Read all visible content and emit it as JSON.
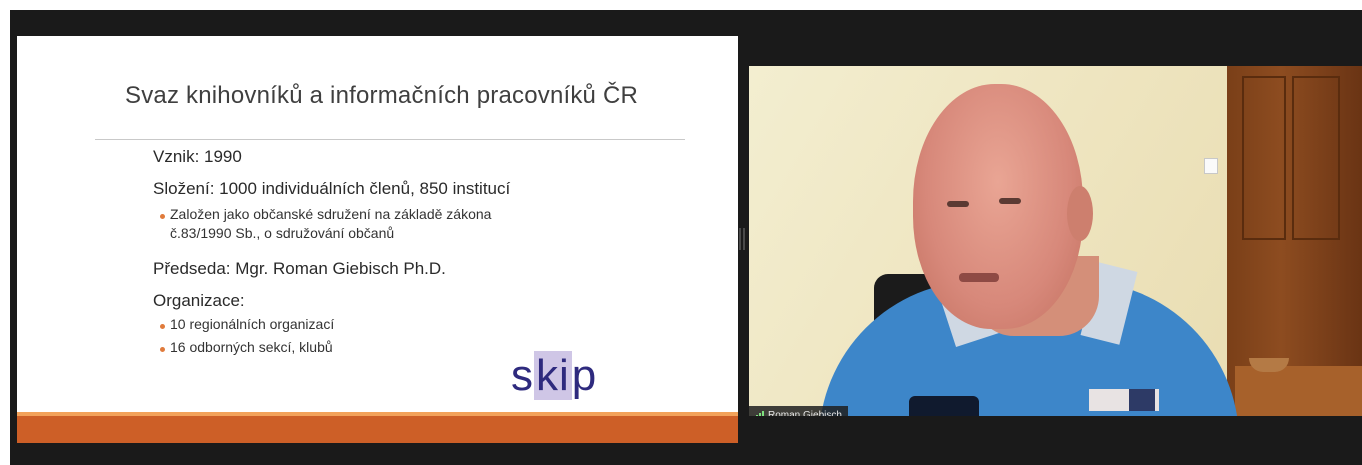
{
  "slide": {
    "title": "Svaz knihovníků a informačních pracovníků ČR",
    "lines": [
      "Vznik: 1990",
      "Složení: 1000 individuálních členů, 850 institucí",
      "Založen jako občanské sdružení na základě zákona",
      "č.83/1990 Sb., o sdružování občanů",
      "Předseda: Mgr. Roman Giebisch Ph.D.",
      "Organizace:",
      "10 regionálních organizací",
      "16 odborných sekcí, klubů"
    ],
    "logo": {
      "part1": "s",
      "highlight": "ki",
      "part2": "p"
    },
    "colors": {
      "bar": "#cd5f27",
      "bar_top": "#f2a25a",
      "bullet": "#e07b3c",
      "logo": "#2e2a7e"
    }
  },
  "video": {
    "participant_name": "Roman Giebisch",
    "icon": "signal-strength-icon"
  }
}
